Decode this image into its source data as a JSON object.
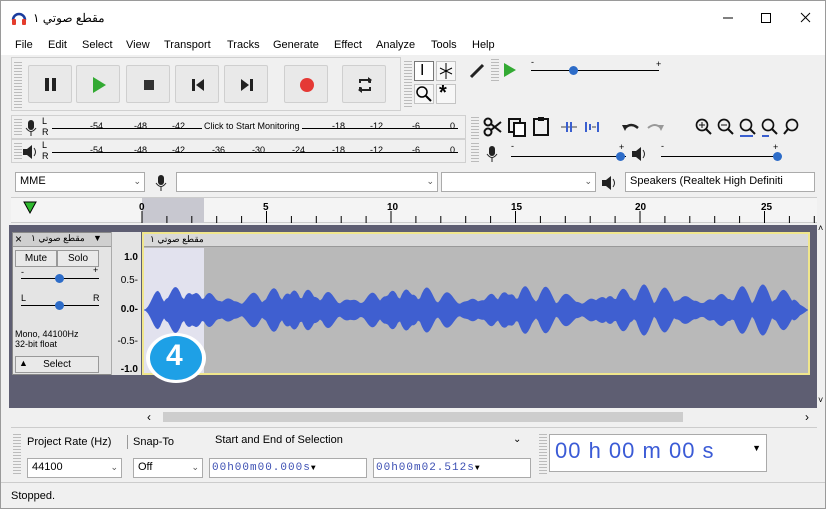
{
  "window": {
    "title": "مقطع صوتي ١",
    "controls": [
      "minimize-icon",
      "maximize-icon",
      "close-icon"
    ]
  },
  "menu": [
    "File",
    "Edit",
    "Select",
    "View",
    "Transport",
    "Tracks",
    "Generate",
    "Effect",
    "Analyze",
    "Tools",
    "Help"
  ],
  "transport": {
    "buttons": [
      "pause-icon",
      "play-icon",
      "stop-icon",
      "skip-start-icon",
      "skip-end-icon",
      "record-icon",
      "loop-icon"
    ],
    "colors": {
      "play": "#33aa33",
      "record": "#e53935",
      "stop": "#333333"
    }
  },
  "meters": {
    "record_labels": [
      "-54",
      "-48",
      "-42",
      "Click to Start Monitoring",
      "-18",
      "-12",
      "-6",
      "0"
    ],
    "play_labels": [
      "-54",
      "-48",
      "-42",
      "-36",
      "-30",
      "-24",
      "-18",
      "-12",
      "-6",
      "0"
    ],
    "lr": [
      "L",
      "R"
    ]
  },
  "devices": {
    "host": "MME",
    "output": "Speakers (Realtek High Definiti"
  },
  "ruler": {
    "labels": [
      "0",
      "5",
      "10",
      "15",
      "20",
      "25"
    ]
  },
  "track": {
    "name": "مقطع صوتي ١",
    "clip_name": "مقطع صوتي ١",
    "mute": "Mute",
    "solo": "Solo",
    "info_line1": "Mono, 44100Hz",
    "info_line2": "32-bit float",
    "select": "Select",
    "scale": [
      "1.0",
      "0.5-",
      "0.0-",
      "-0.5-",
      "-1.0"
    ],
    "gain_plus": "+",
    "gain_minus": "-",
    "pan_l": "L",
    "pan_r": "R"
  },
  "callout": {
    "number": "4",
    "color": "#1ea0e6"
  },
  "selection_bar": {
    "project_rate_label": "Project Rate (Hz)",
    "snap_label": "Snap-To",
    "selection_label": "Start and End of Selection",
    "rate_value": "44100",
    "snap_value": "Off",
    "start": "00h00m00.000s",
    "end": "00h00m02.512s",
    "time_display": "00 h 00 m 00 s"
  },
  "status": "Stopped."
}
